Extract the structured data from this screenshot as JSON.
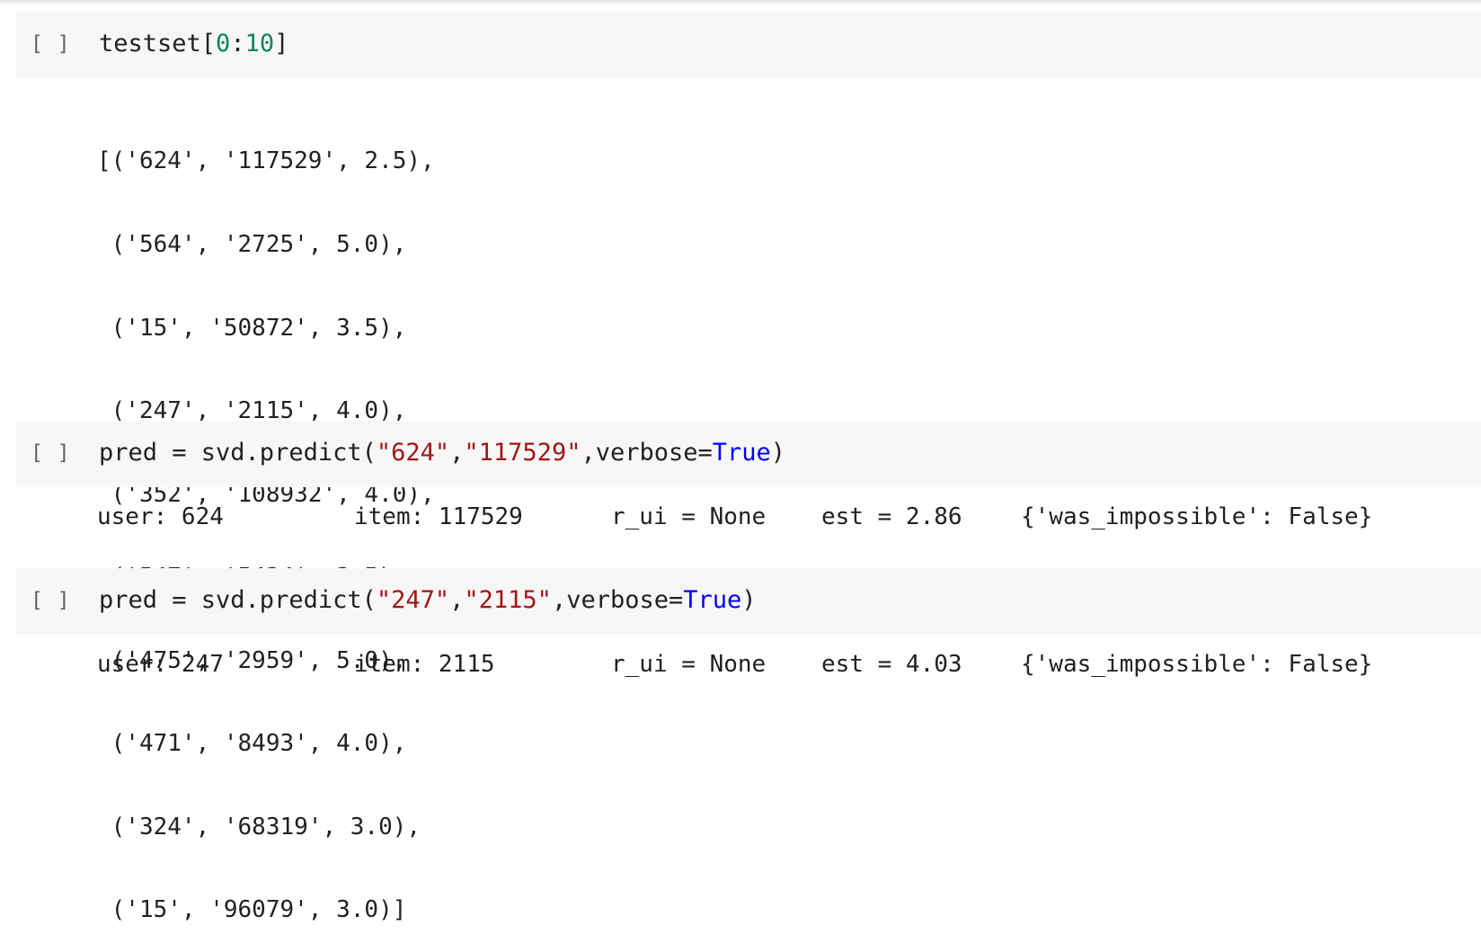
{
  "cells": [
    {
      "run_label": "[ ]",
      "code": {
        "prefix": "testset[",
        "start": "0",
        "sep": ":",
        "end": "10",
        "suffix": "]"
      },
      "output_lines": [
        "[('624', '117529', 2.5),",
        " ('564', '2725', 5.0),",
        " ('15', '50872', 3.5),",
        " ('247', '2115', 4.0),",
        " ('352', '108932', 4.0),",
        " ('547', '5434', 3.5),",
        " ('475', '2959', 5.0),",
        " ('471', '8493', 4.0),",
        " ('324', '68319', 3.0),",
        " ('15', '96079', 3.0)]"
      ]
    },
    {
      "run_label": "[ ]",
      "code": {
        "prefix": "pred = svd.predict(",
        "arg1": "\"624\"",
        "comma": ",",
        "arg2": "\"117529\"",
        "kwarg": ",verbose=",
        "flag": "True",
        "suffix": ")"
      },
      "output": {
        "user": "user: 624",
        "item": "item: 117529",
        "r_ui": "r_ui = None",
        "est": "est = 2.86",
        "details": "{'was_impossible': False}"
      }
    },
    {
      "run_label": "[ ]",
      "code": {
        "prefix": "pred = svd.predict(",
        "arg1": "\"247\"",
        "comma": ",",
        "arg2": "\"2115\"",
        "kwarg": ",verbose=",
        "flag": "True",
        "suffix": ")"
      },
      "output": {
        "user": "user: 247",
        "item": "item: 2115",
        "r_ui": "r_ui = None",
        "est": "est = 4.03",
        "details": "{'was_impossible': False}"
      }
    }
  ]
}
